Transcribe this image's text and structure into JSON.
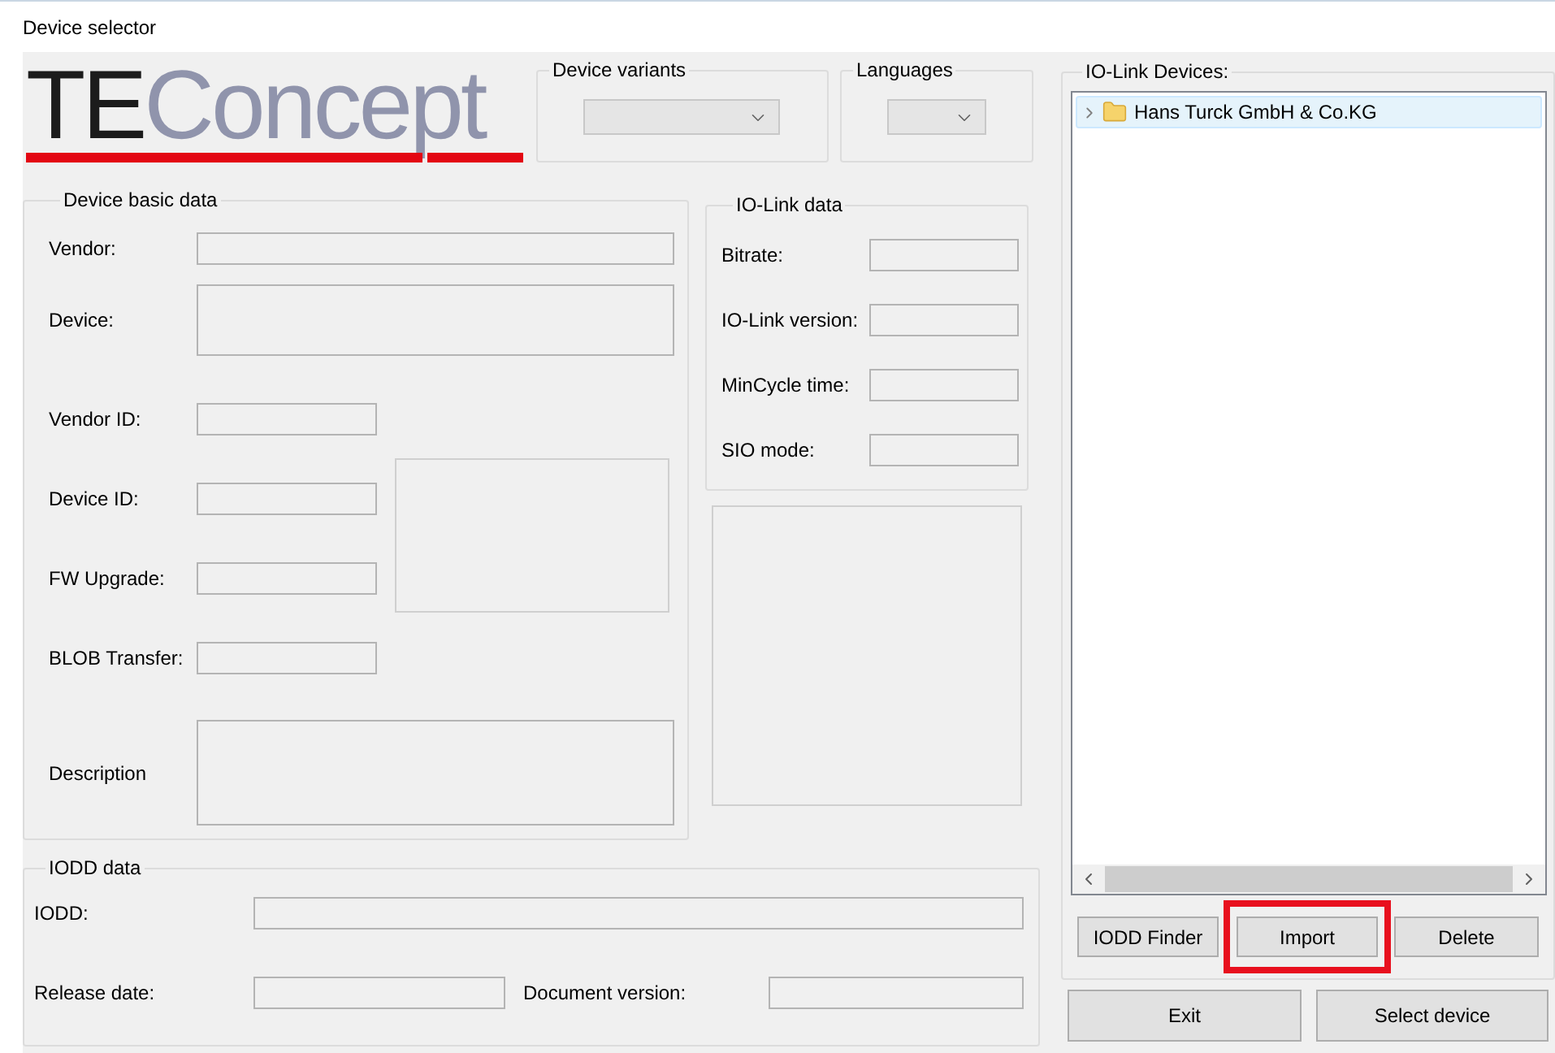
{
  "window": {
    "title": "Device selector"
  },
  "logo": {
    "dark_text": "TE",
    "light_text": "Concept"
  },
  "device_variants": {
    "label": "Device variants"
  },
  "languages": {
    "label": "Languages"
  },
  "device_basic_data": {
    "title": "Device basic data",
    "fields": [
      {
        "label": "Vendor:",
        "kind": "wide"
      },
      {
        "label": "Device:",
        "kind": "tall"
      },
      {
        "label": "Vendor ID:",
        "kind": "short"
      },
      {
        "label": "Device ID:",
        "kind": "short"
      },
      {
        "label": "FW Upgrade:",
        "kind": "short"
      },
      {
        "label": "BLOB Transfer:",
        "kind": "short"
      },
      {
        "label": "Description",
        "kind": "multiline"
      }
    ]
  },
  "io_link_data": {
    "title": "IO-Link data",
    "fields": [
      {
        "label": "Bitrate:"
      },
      {
        "label": "IO-Link version:"
      },
      {
        "label": "MinCycle time:"
      },
      {
        "label": "SIO mode:"
      }
    ]
  },
  "iodd_data": {
    "title": "IODD data",
    "iodd_label": "IODD:",
    "release_date_label": "Release date:",
    "document_version_label": "Document version:"
  },
  "io_link_devices": {
    "title": "IO-Link Devices:",
    "tree": [
      {
        "label": "Hans Turck GmbH & Co.KG",
        "expanded": false,
        "selected": true
      }
    ],
    "buttons": [
      {
        "label": "IODD Finder",
        "highlighted": false
      },
      {
        "label": "Import",
        "highlighted": true
      },
      {
        "label": "Delete",
        "highlighted": false
      }
    ]
  },
  "footer_buttons": [
    "Exit",
    "Select device"
  ]
}
